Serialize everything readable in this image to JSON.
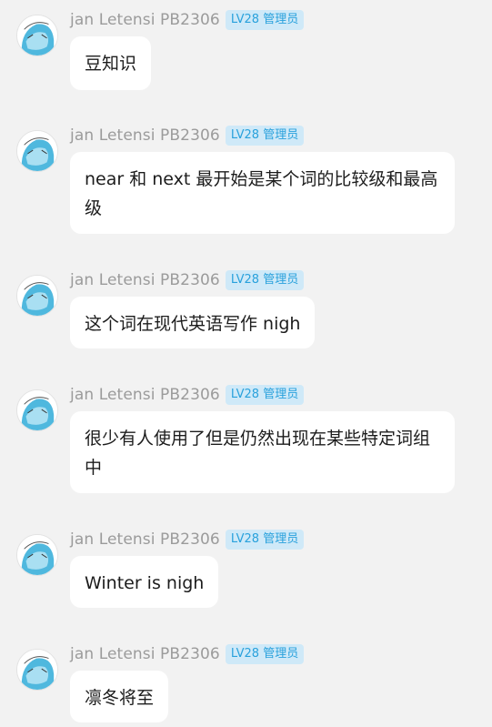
{
  "sender": {
    "name": "jan Letensi PB2306",
    "badge": "LV28 管理员",
    "badge_color": "#29a1dc",
    "badge_bg": "#cfe9f8",
    "avatar_icon": "anime-avatar-icon"
  },
  "messages": [
    {
      "text": "豆知识"
    },
    {
      "text": "near 和 next 最开始是某个词的比较级和最高级"
    },
    {
      "text": "这个词在现代英语写作 nigh"
    },
    {
      "text": "很少有人使用了但是仍然出现在某些特定词组中"
    },
    {
      "text": "Winter is nigh"
    },
    {
      "text": "凛冬将至"
    }
  ]
}
